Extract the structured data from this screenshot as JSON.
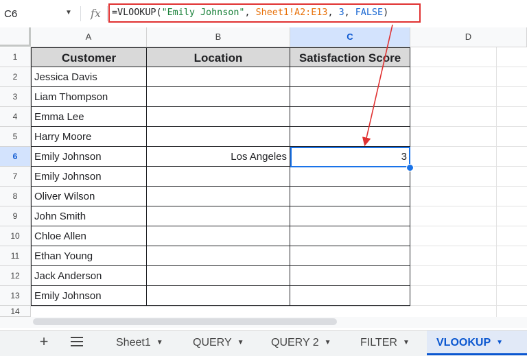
{
  "formula_bar": {
    "cell_ref": "C6",
    "fx_label": "fx",
    "formula": {
      "prefix": "=VLOOKUP(",
      "arg1": "\"Emily Johnson\"",
      "sep1": ", ",
      "arg2": "Sheet1!A2:E13",
      "sep2": ", ",
      "arg3": "3",
      "sep3": ", ",
      "arg4": "FALSE",
      "suffix": ")"
    }
  },
  "columns": [
    "A",
    "B",
    "C",
    "D"
  ],
  "rows": [
    "1",
    "2",
    "3",
    "4",
    "5",
    "6",
    "7",
    "8",
    "9",
    "10",
    "11",
    "12",
    "13",
    "14"
  ],
  "header": {
    "a": "Customer",
    "b": "Location",
    "c": "Satisfaction Score"
  },
  "data": [
    [
      "Jessica Davis",
      "",
      ""
    ],
    [
      "Liam Thompson",
      "",
      ""
    ],
    [
      "Emma Lee",
      "",
      ""
    ],
    [
      "Harry Moore",
      "",
      ""
    ],
    [
      "Emily Johnson",
      "Los Angeles",
      "3"
    ],
    [
      "Emily Johnson",
      "",
      ""
    ],
    [
      "Oliver Wilson",
      "",
      ""
    ],
    [
      "John Smith",
      "",
      ""
    ],
    [
      "Chloe Allen",
      "",
      ""
    ],
    [
      "Ethan Young",
      "",
      ""
    ],
    [
      "Jack Anderson",
      "",
      ""
    ],
    [
      "Emily Johnson",
      "",
      ""
    ]
  ],
  "tabs": [
    "Sheet1",
    "QUERY",
    "QUERY 2",
    "FILTER",
    "VLOOKUP"
  ],
  "active_tab": "VLOOKUP",
  "colors": {
    "accent": "#1a73e8",
    "highlight_box": "#e03131",
    "header_fill": "#d9d9d9"
  }
}
